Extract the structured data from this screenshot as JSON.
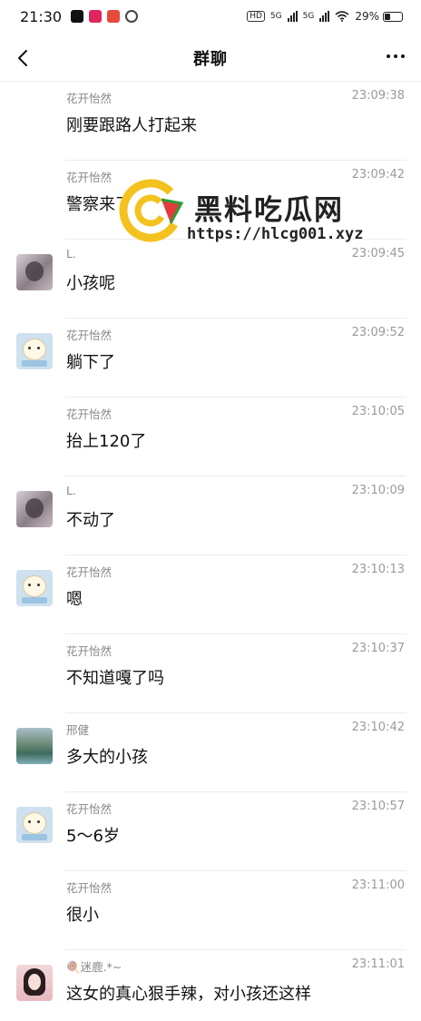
{
  "status": {
    "time": "21:30",
    "network": "5G",
    "battery": "29%",
    "battery_level": 0.29
  },
  "header": {
    "title": "群聊"
  },
  "messages": [
    {
      "name": "花开怡然",
      "time": "23:09:38",
      "text": "刚要跟路人打起来",
      "avatar": "none"
    },
    {
      "name": "花开怡然",
      "time": "23:09:42",
      "text": "警察来了",
      "avatar": "none"
    },
    {
      "name": "L.",
      "time": "23:09:45",
      "text": "小孩呢",
      "avatar": "photo-L"
    },
    {
      "name": "花开怡然",
      "time": "23:09:52",
      "text": "躺下了",
      "avatar": "cartoon-bear"
    },
    {
      "name": "花开怡然",
      "time": "23:10:05",
      "text": "抬上120了",
      "avatar": "none"
    },
    {
      "name": "L.",
      "time": "23:10:09",
      "text": "不动了",
      "avatar": "photo-L"
    },
    {
      "name": "花开怡然",
      "time": "23:10:13",
      "text": "嗯",
      "avatar": "cartoon-bear"
    },
    {
      "name": "花开怡然",
      "time": "23:10:37",
      "text": "不知道嘎了吗",
      "avatar": "none"
    },
    {
      "name": "邢健",
      "time": "23:10:42",
      "text": "多大的小孩",
      "avatar": "landscape"
    },
    {
      "name": "花开怡然",
      "time": "23:10:57",
      "text": "5～6岁",
      "avatar": "cartoon-bear"
    },
    {
      "name": "花开怡然",
      "time": "23:11:00",
      "text": "很小",
      "avatar": "none"
    },
    {
      "name": "🍭迷鹿.*~",
      "time": "23:11:01",
      "text": "这女的真心狠手辣，对小孩还这样",
      "avatar": "portrait"
    }
  ],
  "watermark": {
    "title": "黑料吃瓜网",
    "url": "https://hlcg001.xyz"
  },
  "icons": {
    "back": "chevron-left-icon",
    "more": "more-dots-icon"
  }
}
